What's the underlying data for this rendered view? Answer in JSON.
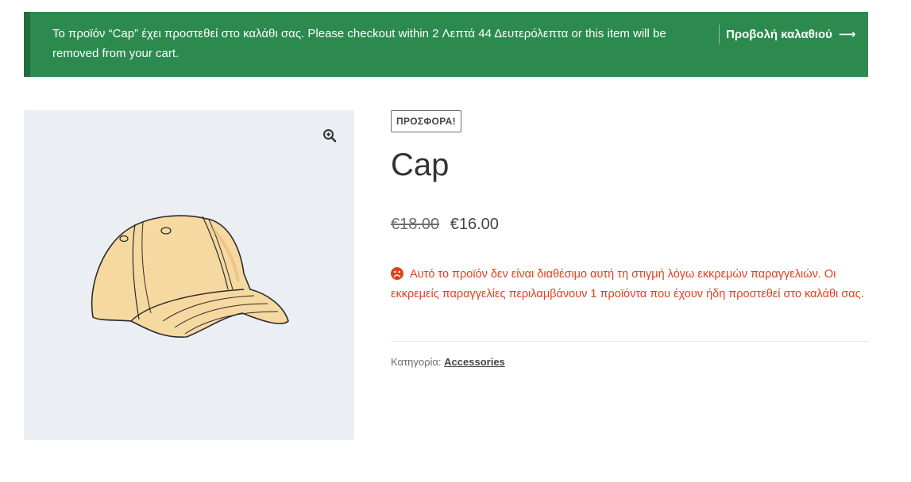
{
  "notice": {
    "message": "Το προϊόν “Cap” έχει προστεθεί στο καλάθι σας. Please checkout within 2 Λεπτά 44 Δευτερόλεπτα or this item will be removed from your cart.",
    "view_cart_label": "Προβολή καλαθιού",
    "arrow": "⟶",
    "background_color": "#2c8a4f"
  },
  "gallery": {
    "zoom_icon": "magnifier-plus-icon",
    "image": "cap-image"
  },
  "product": {
    "badge": "ΠΡΟΣΦΟΡΑ!",
    "title": "Cap",
    "price_old": "€18.00",
    "price_new": "€16.00",
    "stock_icon": "sad-face-icon",
    "stock_message": "Αυτό το προϊόν δεν είναι διαθέσιμο αυτή τη στιγμή λόγω εκκρεμών παραγγελιών. Οι εκκρεμείς παραγγελίες περιλαμβάνουν 1 προϊόντα που έχουν ήδη προστεθεί στο καλάθι σας.",
    "stock_color": "#e2401c",
    "category_label": "Κατηγορία:",
    "category_value": "Accessories"
  }
}
